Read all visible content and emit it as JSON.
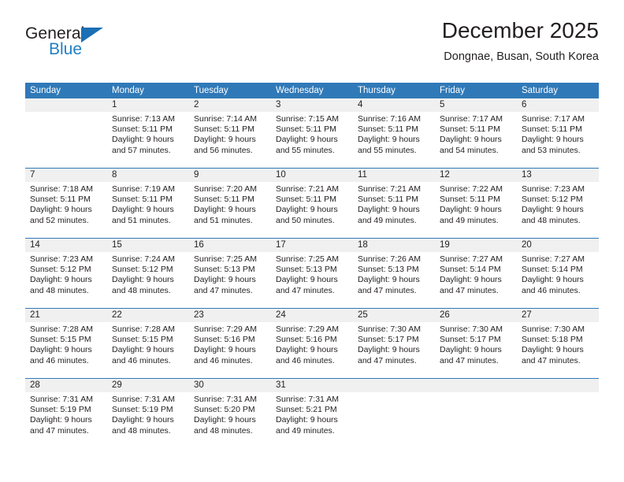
{
  "brand": {
    "name_part1": "General",
    "name_part2": "Blue",
    "accent_color": "#1f7fc4",
    "triangle_color": "#1a6fb5"
  },
  "header": {
    "title": "December 2025",
    "subtitle": "Dongnae, Busan, South Korea"
  },
  "theme": {
    "header_bar_color": "#3079b8",
    "daynum_band_color": "#f0f0f0",
    "text_color": "#231f20"
  },
  "weekdays": [
    "Sunday",
    "Monday",
    "Tuesday",
    "Wednesday",
    "Thursday",
    "Friday",
    "Saturday"
  ],
  "weeks": [
    [
      {
        "day": "",
        "lines": []
      },
      {
        "day": "1",
        "lines": [
          "Sunrise: 7:13 AM",
          "Sunset: 5:11 PM",
          "Daylight: 9 hours",
          "and 57 minutes."
        ]
      },
      {
        "day": "2",
        "lines": [
          "Sunrise: 7:14 AM",
          "Sunset: 5:11 PM",
          "Daylight: 9 hours",
          "and 56 minutes."
        ]
      },
      {
        "day": "3",
        "lines": [
          "Sunrise: 7:15 AM",
          "Sunset: 5:11 PM",
          "Daylight: 9 hours",
          "and 55 minutes."
        ]
      },
      {
        "day": "4",
        "lines": [
          "Sunrise: 7:16 AM",
          "Sunset: 5:11 PM",
          "Daylight: 9 hours",
          "and 55 minutes."
        ]
      },
      {
        "day": "5",
        "lines": [
          "Sunrise: 7:17 AM",
          "Sunset: 5:11 PM",
          "Daylight: 9 hours",
          "and 54 minutes."
        ]
      },
      {
        "day": "6",
        "lines": [
          "Sunrise: 7:17 AM",
          "Sunset: 5:11 PM",
          "Daylight: 9 hours",
          "and 53 minutes."
        ]
      }
    ],
    [
      {
        "day": "7",
        "lines": [
          "Sunrise: 7:18 AM",
          "Sunset: 5:11 PM",
          "Daylight: 9 hours",
          "and 52 minutes."
        ]
      },
      {
        "day": "8",
        "lines": [
          "Sunrise: 7:19 AM",
          "Sunset: 5:11 PM",
          "Daylight: 9 hours",
          "and 51 minutes."
        ]
      },
      {
        "day": "9",
        "lines": [
          "Sunrise: 7:20 AM",
          "Sunset: 5:11 PM",
          "Daylight: 9 hours",
          "and 51 minutes."
        ]
      },
      {
        "day": "10",
        "lines": [
          "Sunrise: 7:21 AM",
          "Sunset: 5:11 PM",
          "Daylight: 9 hours",
          "and 50 minutes."
        ]
      },
      {
        "day": "11",
        "lines": [
          "Sunrise: 7:21 AM",
          "Sunset: 5:11 PM",
          "Daylight: 9 hours",
          "and 49 minutes."
        ]
      },
      {
        "day": "12",
        "lines": [
          "Sunrise: 7:22 AM",
          "Sunset: 5:11 PM",
          "Daylight: 9 hours",
          "and 49 minutes."
        ]
      },
      {
        "day": "13",
        "lines": [
          "Sunrise: 7:23 AM",
          "Sunset: 5:12 PM",
          "Daylight: 9 hours",
          "and 48 minutes."
        ]
      }
    ],
    [
      {
        "day": "14",
        "lines": [
          "Sunrise: 7:23 AM",
          "Sunset: 5:12 PM",
          "Daylight: 9 hours",
          "and 48 minutes."
        ]
      },
      {
        "day": "15",
        "lines": [
          "Sunrise: 7:24 AM",
          "Sunset: 5:12 PM",
          "Daylight: 9 hours",
          "and 48 minutes."
        ]
      },
      {
        "day": "16",
        "lines": [
          "Sunrise: 7:25 AM",
          "Sunset: 5:13 PM",
          "Daylight: 9 hours",
          "and 47 minutes."
        ]
      },
      {
        "day": "17",
        "lines": [
          "Sunrise: 7:25 AM",
          "Sunset: 5:13 PM",
          "Daylight: 9 hours",
          "and 47 minutes."
        ]
      },
      {
        "day": "18",
        "lines": [
          "Sunrise: 7:26 AM",
          "Sunset: 5:13 PM",
          "Daylight: 9 hours",
          "and 47 minutes."
        ]
      },
      {
        "day": "19",
        "lines": [
          "Sunrise: 7:27 AM",
          "Sunset: 5:14 PM",
          "Daylight: 9 hours",
          "and 47 minutes."
        ]
      },
      {
        "day": "20",
        "lines": [
          "Sunrise: 7:27 AM",
          "Sunset: 5:14 PM",
          "Daylight: 9 hours",
          "and 46 minutes."
        ]
      }
    ],
    [
      {
        "day": "21",
        "lines": [
          "Sunrise: 7:28 AM",
          "Sunset: 5:15 PM",
          "Daylight: 9 hours",
          "and 46 minutes."
        ]
      },
      {
        "day": "22",
        "lines": [
          "Sunrise: 7:28 AM",
          "Sunset: 5:15 PM",
          "Daylight: 9 hours",
          "and 46 minutes."
        ]
      },
      {
        "day": "23",
        "lines": [
          "Sunrise: 7:29 AM",
          "Sunset: 5:16 PM",
          "Daylight: 9 hours",
          "and 46 minutes."
        ]
      },
      {
        "day": "24",
        "lines": [
          "Sunrise: 7:29 AM",
          "Sunset: 5:16 PM",
          "Daylight: 9 hours",
          "and 46 minutes."
        ]
      },
      {
        "day": "25",
        "lines": [
          "Sunrise: 7:30 AM",
          "Sunset: 5:17 PM",
          "Daylight: 9 hours",
          "and 47 minutes."
        ]
      },
      {
        "day": "26",
        "lines": [
          "Sunrise: 7:30 AM",
          "Sunset: 5:17 PM",
          "Daylight: 9 hours",
          "and 47 minutes."
        ]
      },
      {
        "day": "27",
        "lines": [
          "Sunrise: 7:30 AM",
          "Sunset: 5:18 PM",
          "Daylight: 9 hours",
          "and 47 minutes."
        ]
      }
    ],
    [
      {
        "day": "28",
        "lines": [
          "Sunrise: 7:31 AM",
          "Sunset: 5:19 PM",
          "Daylight: 9 hours",
          "and 47 minutes."
        ]
      },
      {
        "day": "29",
        "lines": [
          "Sunrise: 7:31 AM",
          "Sunset: 5:19 PM",
          "Daylight: 9 hours",
          "and 48 minutes."
        ]
      },
      {
        "day": "30",
        "lines": [
          "Sunrise: 7:31 AM",
          "Sunset: 5:20 PM",
          "Daylight: 9 hours",
          "and 48 minutes."
        ]
      },
      {
        "day": "31",
        "lines": [
          "Sunrise: 7:31 AM",
          "Sunset: 5:21 PM",
          "Daylight: 9 hours",
          "and 49 minutes."
        ]
      },
      {
        "day": "",
        "lines": []
      },
      {
        "day": "",
        "lines": []
      },
      {
        "day": "",
        "lines": []
      }
    ]
  ]
}
